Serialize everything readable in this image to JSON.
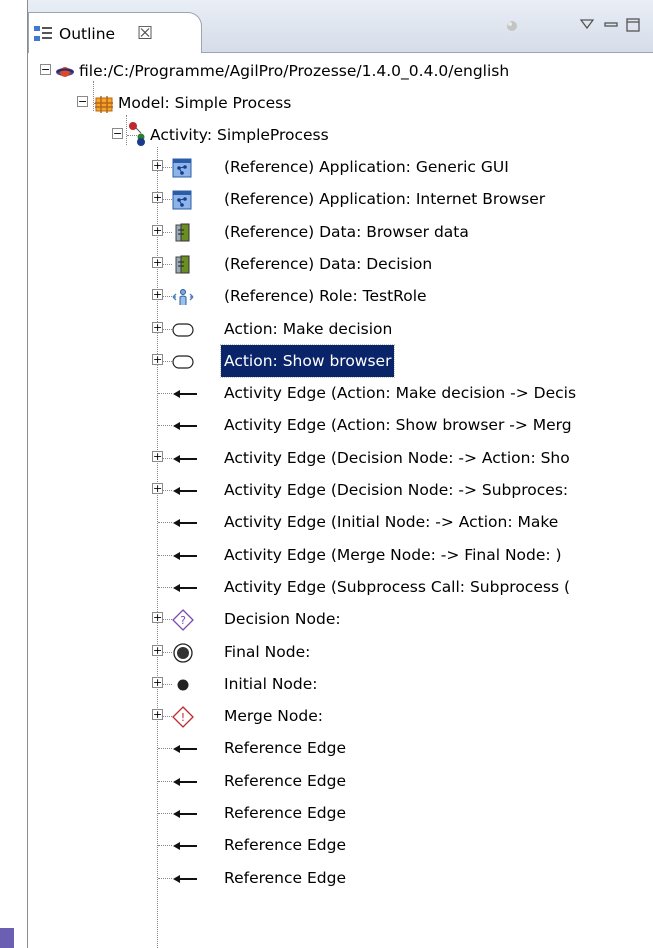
{
  "view": {
    "tab_label": "Outline",
    "tab_close": "☒"
  },
  "tree": {
    "root": "file:/C:/Programme/AgilPro/Prozesse/1.4.0_0.4.0/english",
    "model": "Model: Simple Process",
    "activity": "Activity: SimpleProcess",
    "items": [
      {
        "label": "(Reference) Application: Generic GUI",
        "icon": "application-icon",
        "expandable": true
      },
      {
        "label": "(Reference) Application: Internet Browser",
        "icon": "application-icon",
        "expandable": true
      },
      {
        "label": "(Reference) Data: Browser data",
        "icon": "data-icon",
        "expandable": true
      },
      {
        "label": "(Reference) Data: Decision",
        "icon": "data-icon",
        "expandable": true
      },
      {
        "label": "(Reference) Role: TestRole",
        "icon": "role-icon",
        "expandable": true
      },
      {
        "label": "Action: Make decision",
        "icon": "action-icon",
        "expandable": true
      },
      {
        "label": "Action: Show browser",
        "icon": "action-icon",
        "expandable": true,
        "selected": true
      },
      {
        "label": "Activity Edge (Action: Make decision -> Decis",
        "icon": "edge-arrow-icon",
        "expandable": false
      },
      {
        "label": "Activity Edge (Action: Show browser -> Merg",
        "icon": "edge-arrow-icon",
        "expandable": false
      },
      {
        "label": "Activity Edge (Decision Node:  -> Action: Sho",
        "icon": "edge-arrow-icon",
        "expandable": true
      },
      {
        "label": "Activity Edge (Decision Node:  -> Subproces:",
        "icon": "edge-arrow-icon",
        "expandable": true
      },
      {
        "label": "Activity Edge (Initial Node:  -> Action: Make",
        "icon": "edge-arrow-icon",
        "expandable": false
      },
      {
        "label": "Activity Edge (Merge Node:  -> Final Node: )",
        "icon": "edge-arrow-icon",
        "expandable": false
      },
      {
        "label": "Activity Edge (Subprocess Call: Subprocess (",
        "icon": "edge-arrow-icon",
        "expandable": false
      },
      {
        "label": "Decision Node:",
        "icon": "decision-node-icon",
        "expandable": true
      },
      {
        "label": "Final Node:",
        "icon": "final-node-icon",
        "expandable": true
      },
      {
        "label": "Initial Node:",
        "icon": "initial-node-icon",
        "expandable": true
      },
      {
        "label": "Merge Node:",
        "icon": "merge-node-icon",
        "expandable": true
      },
      {
        "label": "Reference Edge",
        "icon": "edge-arrow-icon",
        "expandable": false
      },
      {
        "label": "Reference Edge",
        "icon": "edge-arrow-icon",
        "expandable": false
      },
      {
        "label": "Reference Edge",
        "icon": "edge-arrow-icon",
        "expandable": false
      },
      {
        "label": "Reference Edge",
        "icon": "edge-arrow-icon",
        "expandable": false
      },
      {
        "label": "Reference Edge",
        "icon": "edge-arrow-icon",
        "expandable": false
      }
    ]
  },
  "colors": {
    "selection": "#0a246a",
    "accent_strip": "#6b5fb3"
  }
}
